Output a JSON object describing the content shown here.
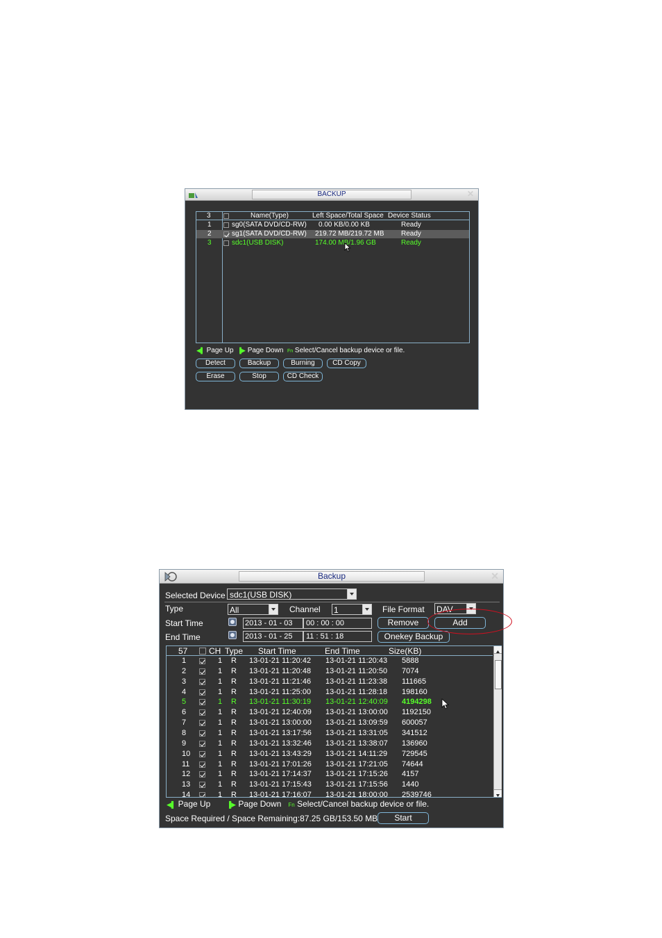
{
  "top_dialog": {
    "title": "BACKUP",
    "header": {
      "count": "3",
      "name": "Name(Type)",
      "space": "Left Space/Total Space",
      "status": "Device Status"
    },
    "rows": [
      {
        "no": "1",
        "name": "sg0(SATA DVD/CD-RW)",
        "space": "0.00 KB/0.00 KB",
        "status": "Ready",
        "checked": false,
        "selected": false,
        "highlight": false
      },
      {
        "no": "2",
        "name": "sg1(SATA DVD/CD-RW)",
        "space": "219.72 MB/219.72 MB",
        "status": "Ready",
        "checked": true,
        "selected": true,
        "highlight": false
      },
      {
        "no": "3",
        "name": "sdc1(USB DISK)",
        "space": "174.00 MB/1.96 GB",
        "status": "Ready",
        "checked": false,
        "selected": false,
        "highlight": true
      }
    ],
    "hints": {
      "page_up": "Page Up",
      "page_down": "Page Down",
      "fn": "Fn",
      "select": "Select/Cancel backup device or file."
    },
    "buttons_row1": [
      "Detect",
      "Backup",
      "Burning",
      "CD Copy"
    ],
    "buttons_row2": [
      "Erase",
      "Stop",
      "CD Check"
    ]
  },
  "bottom_dialog": {
    "title": "Backup",
    "selected_device_label": "Selected Device",
    "selected_device_value": "sdc1(USB DISK)",
    "type_label": "Type",
    "type_value": "All",
    "channel_label": "Channel",
    "channel_value": "1",
    "file_format_label": "File Format",
    "file_format_value": "DAV",
    "start_time_label": "Start Time",
    "start_date": "2013  - 01 - 03",
    "start_time": "00 :  00 :  00",
    "end_time_label": "End Time",
    "end_date": "2013  - 01 - 25",
    "end_time": "11 :  51 :  18",
    "remove_label": "Remove",
    "add_label": "Add",
    "onekey_label": "Onekey Backup",
    "table_header": {
      "count": "57",
      "ch": "CH",
      "type": "Type",
      "start": "Start Time",
      "end": "End Time",
      "size": "Size(KB)"
    },
    "rows": [
      {
        "no": "1",
        "ch": "1",
        "type": "R",
        "start": "13-01-21 11:20:42",
        "end": "13-01-21 11:20:43",
        "size": "5888",
        "highlight": false
      },
      {
        "no": "2",
        "ch": "1",
        "type": "R",
        "start": "13-01-21 11:20:48",
        "end": "13-01-21 11:20:50",
        "size": "7074",
        "highlight": false
      },
      {
        "no": "3",
        "ch": "1",
        "type": "R",
        "start": "13-01-21 11:21:46",
        "end": "13-01-21 11:23:38",
        "size": "111665",
        "highlight": false
      },
      {
        "no": "4",
        "ch": "1",
        "type": "R",
        "start": "13-01-21 11:25:00",
        "end": "13-01-21 11:28:18",
        "size": "198160",
        "highlight": false
      },
      {
        "no": "5",
        "ch": "1",
        "type": "R",
        "start": "13-01-21 11:30:19",
        "end": "13-01-21 12:40:09",
        "size": "4194298",
        "highlight": true
      },
      {
        "no": "6",
        "ch": "1",
        "type": "R",
        "start": "13-01-21 12:40:09",
        "end": "13-01-21 13:00:00",
        "size": "1192150",
        "highlight": false
      },
      {
        "no": "7",
        "ch": "1",
        "type": "R",
        "start": "13-01-21 13:00:00",
        "end": "13-01-21 13:09:59",
        "size": "600057",
        "highlight": false
      },
      {
        "no": "8",
        "ch": "1",
        "type": "R",
        "start": "13-01-21 13:17:56",
        "end": "13-01-21 13:31:05",
        "size": "341512",
        "highlight": false
      },
      {
        "no": "9",
        "ch": "1",
        "type": "R",
        "start": "13-01-21 13:32:46",
        "end": "13-01-21 13:38:07",
        "size": "136960",
        "highlight": false
      },
      {
        "no": "10",
        "ch": "1",
        "type": "R",
        "start": "13-01-21 13:43:29",
        "end": "13-01-21 14:11:29",
        "size": "729545",
        "highlight": false
      },
      {
        "no": "11",
        "ch": "1",
        "type": "R",
        "start": "13-01-21 17:01:26",
        "end": "13-01-21 17:21:05",
        "size": "74644",
        "highlight": false
      },
      {
        "no": "12",
        "ch": "1",
        "type": "R",
        "start": "13-01-21 17:14:37",
        "end": "13-01-21 17:15:26",
        "size": "4157",
        "highlight": false
      },
      {
        "no": "13",
        "ch": "1",
        "type": "R",
        "start": "13-01-21 17:15:43",
        "end": "13-01-21 17:15:56",
        "size": "1440",
        "highlight": false
      },
      {
        "no": "14",
        "ch": "1",
        "type": "R",
        "start": "13-01-21 17:16:07",
        "end": "13-01-21 18:00:00",
        "size": "2539746",
        "highlight": false
      }
    ],
    "hints": {
      "page_up": "Page Up",
      "page_down": "Page Down",
      "fn": "Fn",
      "select": "Select/Cancel backup device or file."
    },
    "space_text": "Space Required / Space Remaining:87.25 GB/153.50 MB",
    "start_button": "Start"
  },
  "colors": {
    "window_bg": "#333333",
    "highlight_green": "#57ff2a",
    "annotation_red": "#d01020",
    "panel_border": "#8ab0c8"
  }
}
